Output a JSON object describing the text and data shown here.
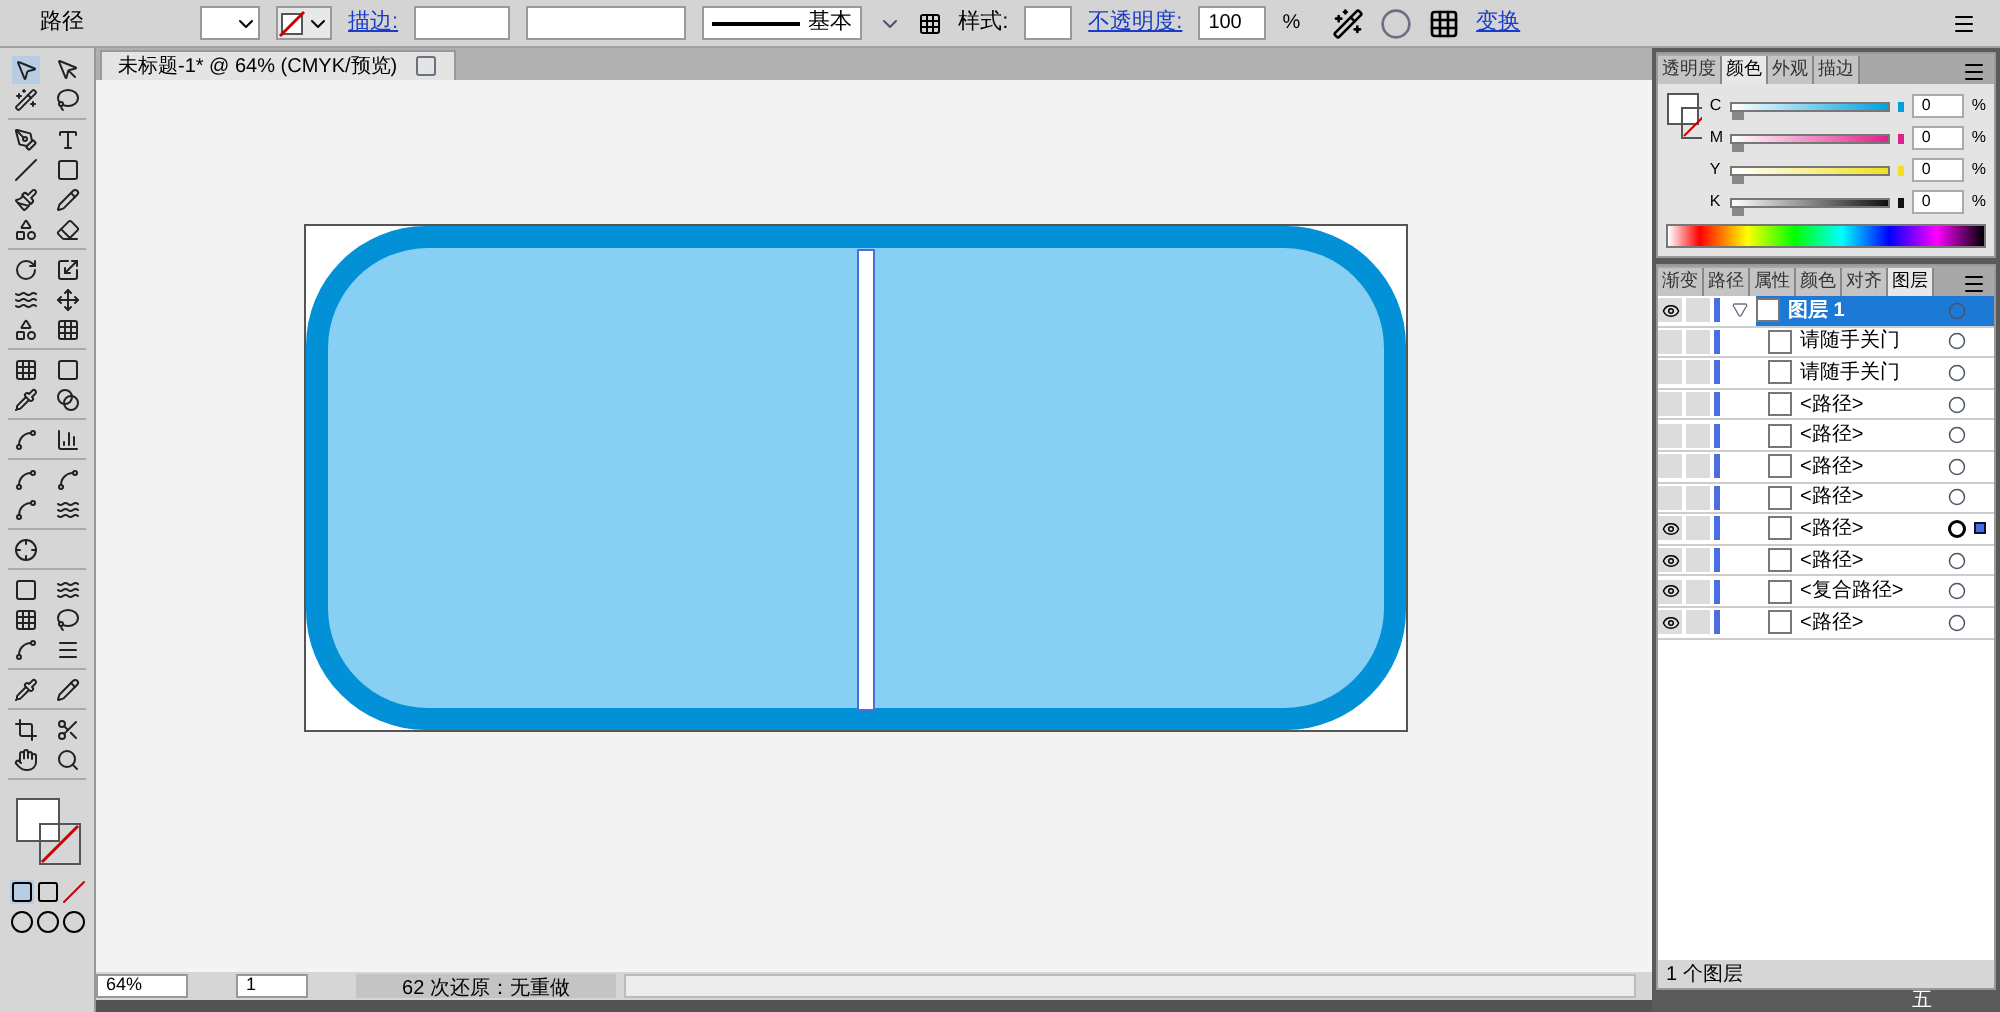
{
  "control_bar": {
    "object_type": "路径",
    "stroke_label": "描边:",
    "stroke_style": "基本",
    "style_label": "样式:",
    "opacity_label": "不透明度:",
    "opacity_value": "100",
    "opacity_unit": "%",
    "transform_link": "变换"
  },
  "document_tab": {
    "title": "未标题-1* @ 64% (CMYK/预览)"
  },
  "color_panel": {
    "tabs": [
      {
        "label": "透明度",
        "selected": false
      },
      {
        "label": "颜色",
        "selected": true
      },
      {
        "label": "外观",
        "selected": false
      },
      {
        "label": "描边",
        "selected": false
      }
    ],
    "channels": [
      {
        "name": "C",
        "value": "0",
        "unit": "%",
        "color": "#00a0e0",
        "level": 0
      },
      {
        "name": "M",
        "value": "0",
        "unit": "%",
        "color": "#e0208a",
        "level": 0
      },
      {
        "name": "Y",
        "value": "0",
        "unit": "%",
        "color": "#f0e020",
        "level": 0
      },
      {
        "name": "K",
        "value": "0",
        "unit": "%",
        "color": "#111111",
        "level": 0
      }
    ]
  },
  "layers_panel": {
    "tabs": [
      {
        "label": "渐变",
        "selected": false
      },
      {
        "label": "路径",
        "selected": false
      },
      {
        "label": "属性",
        "selected": false
      },
      {
        "label": "颜色",
        "selected": false
      },
      {
        "label": "对齐",
        "selected": false
      },
      {
        "label": "图层",
        "selected": true
      }
    ],
    "layers": [
      {
        "name": "图层 1",
        "visible": true,
        "selected": true,
        "expanded": true,
        "targeted": false,
        "children": [
          {
            "name": "请随手关门",
            "visible": false,
            "selected": false,
            "targeted": false
          },
          {
            "name": "请随手关门",
            "visible": false,
            "selected": false,
            "targeted": false
          },
          {
            "name": "<路径>",
            "visible": false,
            "selected": false,
            "targeted": false
          },
          {
            "name": "<路径>",
            "visible": false,
            "selected": false,
            "targeted": false
          },
          {
            "name": "<路径>",
            "visible": false,
            "selected": false,
            "targeted": false
          },
          {
            "name": "<路径>",
            "visible": false,
            "selected": false,
            "targeted": false
          },
          {
            "name": "<路径>",
            "visible": true,
            "selected": false,
            "targeted": true
          },
          {
            "name": "<路径>",
            "visible": true,
            "selected": false,
            "targeted": false
          },
          {
            "name": "<复合路径>",
            "visible": true,
            "selected": false,
            "targeted": false
          },
          {
            "name": "<路径>",
            "visible": true,
            "selected": false,
            "targeted": false
          }
        ]
      }
    ],
    "layer_count": "1 个图层"
  },
  "status_bar": {
    "zoom": "64%",
    "artboard": "1",
    "undo_status": "62 次还原：无重做"
  },
  "tray": {
    "ime": "五"
  }
}
